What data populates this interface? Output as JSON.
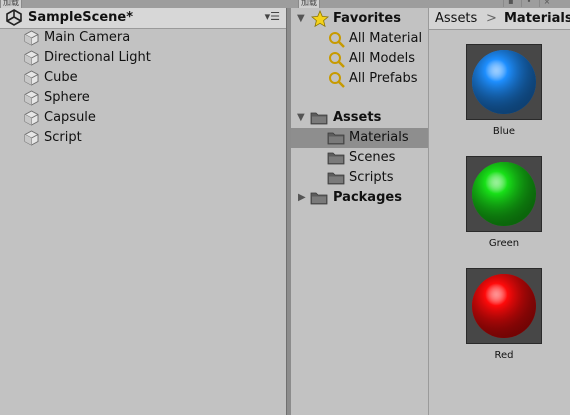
{
  "top_strip": {
    "left_tab_text": "加载",
    "right_tab_text": "加载"
  },
  "hierarchy": {
    "scene_title": "SampleScene*",
    "menu_icon": "menu-lines-icon",
    "items": [
      {
        "label": "Main Camera"
      },
      {
        "label": "Directional Light"
      },
      {
        "label": "Cube"
      },
      {
        "label": "Sphere"
      },
      {
        "label": "Capsule"
      },
      {
        "label": "Script"
      }
    ]
  },
  "project_tree": {
    "favorites": {
      "label": "Favorites",
      "items": [
        {
          "label": "All Material"
        },
        {
          "label": "All Models"
        },
        {
          "label": "All Prefabs"
        }
      ]
    },
    "assets": {
      "label": "Assets",
      "items": [
        {
          "label": "Materials",
          "selected": true
        },
        {
          "label": "Scenes"
        },
        {
          "label": "Scripts"
        }
      ]
    },
    "packages": {
      "label": "Packages"
    }
  },
  "breadcrumb": {
    "root": "Assets",
    "separator": ">",
    "current": "Materials"
  },
  "assets_grid": [
    {
      "name": "Blue",
      "color": "#1e8fff"
    },
    {
      "name": "Green",
      "color": "#18e018"
    },
    {
      "name": "Red",
      "color": "#ff0a0a"
    }
  ],
  "colors": {
    "panel_bg": "#c2c2c2",
    "selected_row": "#8e8e8e",
    "thumb_bg": "#474747"
  }
}
